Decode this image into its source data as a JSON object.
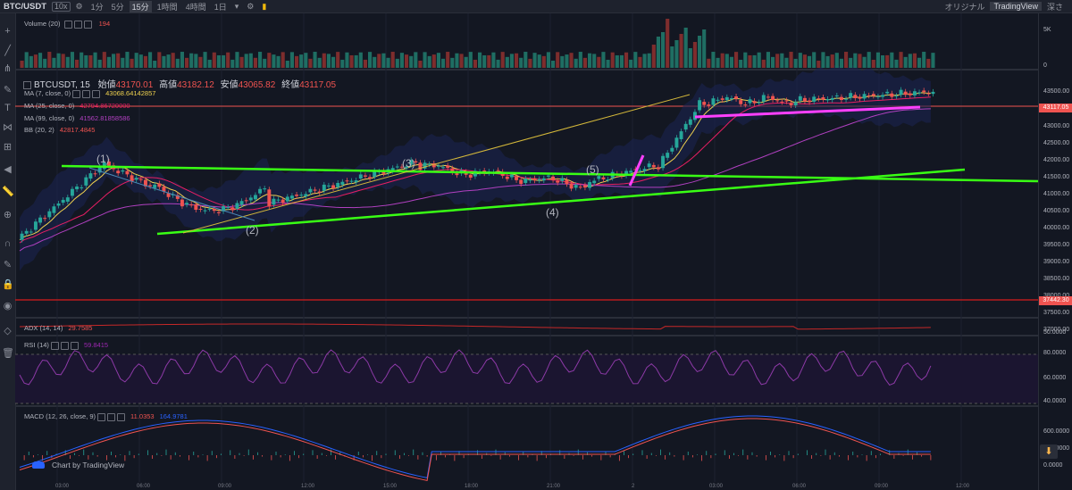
{
  "topbar": {
    "symbol": "BTC/USDT",
    "leverage": "10x",
    "intervals": [
      "1分",
      "5分",
      "15分",
      "1時間",
      "4時間",
      "1日"
    ],
    "active_interval": "15分",
    "right_items": [
      "オリジナル",
      "TradingView",
      "深さ"
    ]
  },
  "main_pane": {
    "ohlc_title": "BTCUSDT, 15",
    "open_label": "始値",
    "open": "43170.01",
    "high_label": "高値",
    "high": "43182.12",
    "low_label": "安値",
    "low": "43065.82",
    "close_label": "終値",
    "close": "43117.05",
    "indicators": [
      {
        "label": "MA (7, close, 0)",
        "value": "43068.64142857",
        "color": "#f0d24f"
      },
      {
        "label": "MA (25, close, 0)",
        "value": "42794.86720000",
        "color": "#e91e63"
      },
      {
        "label": "MA (99, close, 0)",
        "value": "41562.81858586",
        "color": "#b040c0"
      },
      {
        "label": "BB (20, 2)",
        "value": "42817.4845",
        "color": "#ef5350"
      }
    ],
    "price_tags": [
      {
        "value": "43117.05",
        "color": "#ef5350"
      },
      {
        "value": "37442.30",
        "color": "#ef5350"
      }
    ],
    "y_ticks": [
      "43500.00",
      "43000.00",
      "42500.00",
      "42000.00",
      "41500.00",
      "41000.00",
      "40500.00",
      "40000.00",
      "39500.00",
      "39000.00",
      "38500.00",
      "38000.00",
      "37500.00",
      "37000.00"
    ],
    "wave_labels": [
      "(1)",
      "(2)",
      "(3)",
      "(4)",
      "(5)"
    ]
  },
  "volume_pane": {
    "label": "Volume (20)",
    "value": "194",
    "y_ticks": [
      "5K",
      "0"
    ]
  },
  "adx_pane": {
    "label": "ADX (14, 14)",
    "value": "29.7585",
    "y_ticks": [
      "50.0000"
    ]
  },
  "rsi_pane": {
    "label": "RSI (14)",
    "value": "59.8415",
    "y_ticks": [
      "80.0000",
      "60.0000",
      "40.0000"
    ]
  },
  "macd_pane": {
    "label": "MACD (12, 26, close, 9)",
    "values": [
      "11.0353",
      "164.9781"
    ],
    "y_ticks": [
      "600.0000",
      "400.0000",
      "0.0000"
    ]
  },
  "x_ticks": [
    "03:00",
    "06:00",
    "09:00",
    "12:00",
    "15:00",
    "18:00",
    "21:00",
    "2",
    "03:00",
    "06:00",
    "09:00",
    "12:00"
  ],
  "watermark": "Chart by TradingView",
  "colors": {
    "up": "#26a69a",
    "down": "#ef5350",
    "bg": "#131722",
    "trend": "#39ff14",
    "magenta": "#ff40ff"
  }
}
